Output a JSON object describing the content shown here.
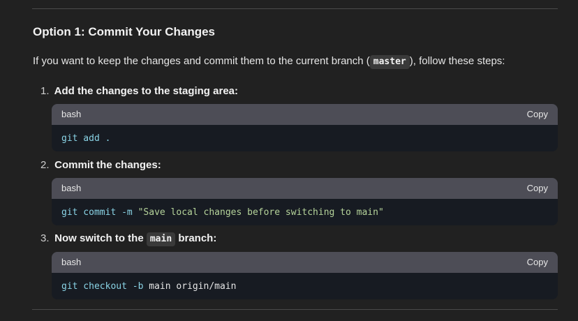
{
  "heading": "Option 1: Commit Your Changes",
  "intro": {
    "before": "If you want to keep the changes and commit them to the current branch (",
    "code": "master",
    "after": "), follow these steps:"
  },
  "steps": [
    {
      "number": "1.",
      "text": "Add the changes to the staging area:",
      "code_block": {
        "language": "bash",
        "copy_label": "Copy",
        "tokens": [
          {
            "text": "git add",
            "kind": "cmd"
          },
          {
            "text": " .",
            "kind": "cmd"
          }
        ]
      }
    },
    {
      "number": "2.",
      "text": "Commit the changes:",
      "code_block": {
        "language": "bash",
        "copy_label": "Copy",
        "tokens": [
          {
            "text": "git commit",
            "kind": "cmd"
          },
          {
            "text": " -m",
            "kind": "flag"
          },
          {
            "text": " \"Save local changes before switching to main\"",
            "kind": "str"
          }
        ]
      }
    },
    {
      "number": "3.",
      "text_before": "Now switch to the ",
      "inline_code": "main",
      "text_after": " branch:",
      "code_block": {
        "language": "bash",
        "copy_label": "Copy",
        "tokens": [
          {
            "text": "git checkout",
            "kind": "cmd"
          },
          {
            "text": " -b",
            "kind": "flag"
          },
          {
            "text": " main origin/main",
            "kind": "plain"
          }
        ]
      }
    }
  ],
  "colors": {
    "background": "#212121",
    "code_background": "#171b22",
    "code_header": "#4d4d56",
    "command": "#8ad4e6",
    "string": "#b5d39a"
  }
}
